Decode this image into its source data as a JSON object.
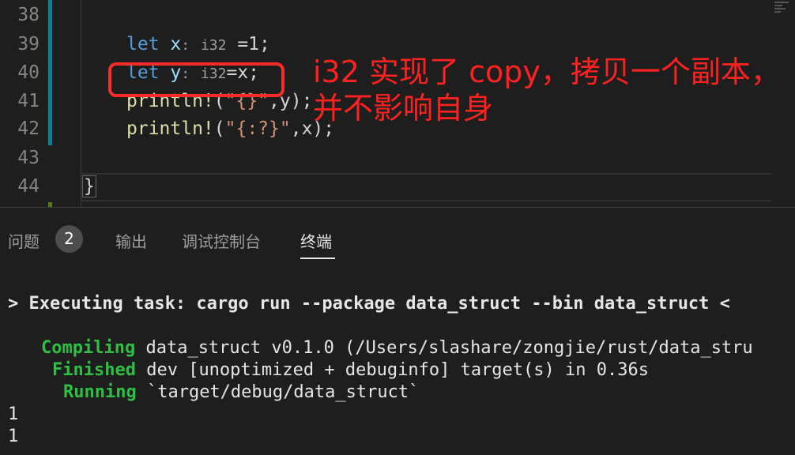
{
  "editor": {
    "line_numbers": [
      "38",
      "39",
      "40",
      "41",
      "42",
      "43",
      "44"
    ],
    "code": {
      "l39": {
        "kw": "let",
        "var": "x",
        "colon": ":",
        "hint": "i32",
        "rest": " =1;"
      },
      "l40": {
        "kw": "let",
        "var": "y",
        "colon": ":",
        "hint": "i32",
        "rest": "=x;"
      },
      "l41": {
        "fn": "println!",
        "open": "(",
        "str": "\"{}\"",
        "rest": ",y);"
      },
      "l42": {
        "fn": "println!",
        "open": "(",
        "str": "\"{:?}\"",
        "rest": ",x);"
      },
      "l44": {
        "brace": "}"
      }
    }
  },
  "annotation": {
    "text": "i32 实现了 copy，拷贝一个副本，并不影响自身",
    "color": "#ff2020"
  },
  "panel": {
    "tabs": [
      {
        "label": "问题",
        "badge": "2"
      },
      {
        "label": "输出"
      },
      {
        "label": "调试控制台"
      },
      {
        "label": "终端",
        "active": true
      }
    ]
  },
  "terminal": {
    "task_line": "> Executing task: cargo run --package data_struct --bin data_struct <",
    "compiling_label": "Compiling",
    "compiling_text": " data_struct v0.1.0 (/Users/slashare/zongjie/rust/data_stru",
    "finished_label": "Finished",
    "finished_text": " dev [unoptimized + debuginfo] target(s) in 0.36s",
    "running_label": "Running",
    "running_text": " `target/debug/data_struct`",
    "output": [
      "1",
      "1"
    ]
  }
}
